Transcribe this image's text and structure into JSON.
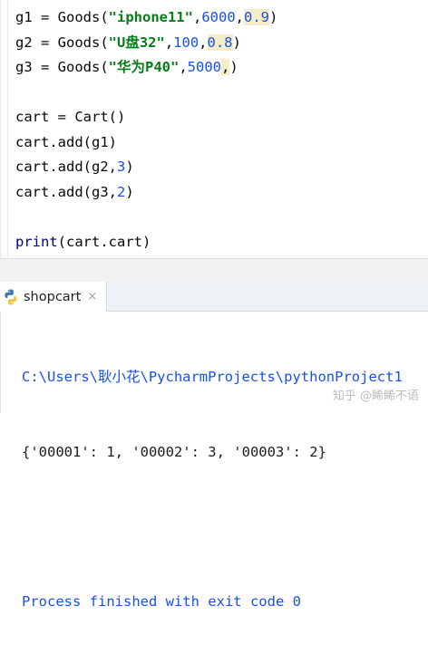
{
  "editor": {
    "lines": [
      {
        "segments": [
          {
            "text": "g1 = Goods(",
            "cls": "plain"
          },
          {
            "text": "\"iphone11\"",
            "cls": "str"
          },
          {
            "text": ",",
            "cls": "plain"
          },
          {
            "text": "6000",
            "cls": "num"
          },
          {
            "text": ",",
            "cls": "plain"
          },
          {
            "text": "0.9",
            "cls": "num hint"
          },
          {
            "text": ")",
            "cls": "plain"
          }
        ]
      },
      {
        "segments": [
          {
            "text": "g2 = Goods(",
            "cls": "plain"
          },
          {
            "text": "\"U盘32\"",
            "cls": "str"
          },
          {
            "text": ",",
            "cls": "plain"
          },
          {
            "text": "100",
            "cls": "num"
          },
          {
            "text": ",",
            "cls": "plain"
          },
          {
            "text": "0.8",
            "cls": "num hint"
          },
          {
            "text": ")",
            "cls": "plain"
          }
        ]
      },
      {
        "segments": [
          {
            "text": "g3 = Goods(",
            "cls": "plain"
          },
          {
            "text": "\"华为P40\"",
            "cls": "str"
          },
          {
            "text": ",",
            "cls": "plain"
          },
          {
            "text": "5000",
            "cls": "num"
          },
          {
            "text": ",",
            "cls": "plain hint"
          },
          {
            "text": ")",
            "cls": "plain"
          }
        ]
      },
      {
        "segments": []
      },
      {
        "segments": [
          {
            "text": "cart = Cart()",
            "cls": "plain"
          }
        ]
      },
      {
        "segments": [
          {
            "text": "cart.add(g1)",
            "cls": "plain"
          }
        ]
      },
      {
        "segments": [
          {
            "text": "cart.add(g2,",
            "cls": "plain"
          },
          {
            "text": "3",
            "cls": "num"
          },
          {
            "text": ")",
            "cls": "plain"
          }
        ]
      },
      {
        "segments": [
          {
            "text": "cart.add(g3,",
            "cls": "plain"
          },
          {
            "text": "2",
            "cls": "num"
          },
          {
            "text": ")",
            "cls": "plain"
          }
        ]
      },
      {
        "segments": []
      },
      {
        "segments": [
          {
            "text": "print",
            "cls": "builtin"
          },
          {
            "text": "(cart.cart)",
            "cls": "plain"
          }
        ]
      }
    ]
  },
  "run_panel": {
    "tab_label": "shopcart",
    "tab_close": "×",
    "tab_icon": "python-icon"
  },
  "console": {
    "path_line": "C:\\Users\\耿小花\\PycharmProjects\\pythonProject1",
    "output_line": "{'00001': 1, '00002': 3, '00003': 2}",
    "exit_line": "Process finished with exit code 0"
  },
  "watermark": "知乎 @睎睎不语",
  "colors": {
    "string": "#067d17",
    "number": "#1750eb",
    "param_hint_bg": "#f5edc8",
    "builtin": "#000080"
  }
}
